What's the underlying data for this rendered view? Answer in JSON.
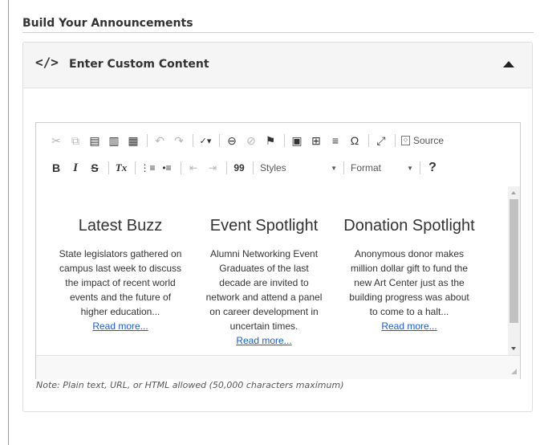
{
  "section_title": "Build Your Announcements",
  "panel": {
    "title": "Enter Custom Content",
    "code_icon": "</>"
  },
  "toolbar": {
    "source_label": "Source",
    "styles_label": "Styles",
    "format_label": "Format",
    "help_label": "?",
    "bold_label": "B",
    "italic_label": "I",
    "strike_label": "S",
    "clear_format_label": "Tx",
    "blockquote_label": "99",
    "omega_label": "Ω"
  },
  "columns": [
    {
      "heading": "Latest Buzz",
      "lines": [
        "State legislators gathered on",
        "campus last week to discuss",
        "the impact of recent world",
        "events and the future of",
        "higher education..."
      ],
      "link": "Read more..."
    },
    {
      "heading": "Event Spotlight",
      "lines": [
        "Alumni Networking Event",
        "Graduates of the last",
        "decade are invited to",
        "network and attend a panel",
        "on career development in",
        "uncertain times."
      ],
      "link": "Read more..."
    },
    {
      "heading": "Donation Spotlight",
      "lines": [
        "Anonymous donor makes",
        "million dollar gift to fund the",
        "new Art Center just as the",
        "building progress was about",
        "to come to a halt..."
      ],
      "link": "Read more..."
    }
  ],
  "note": "Note: Plain text, URL, or HTML allowed (50,000 characters maximum)",
  "colors": {
    "link": "#1a5cc8",
    "panel_header_bg": "#f5f5f5",
    "disabled_icon": "#b4b4b4"
  }
}
